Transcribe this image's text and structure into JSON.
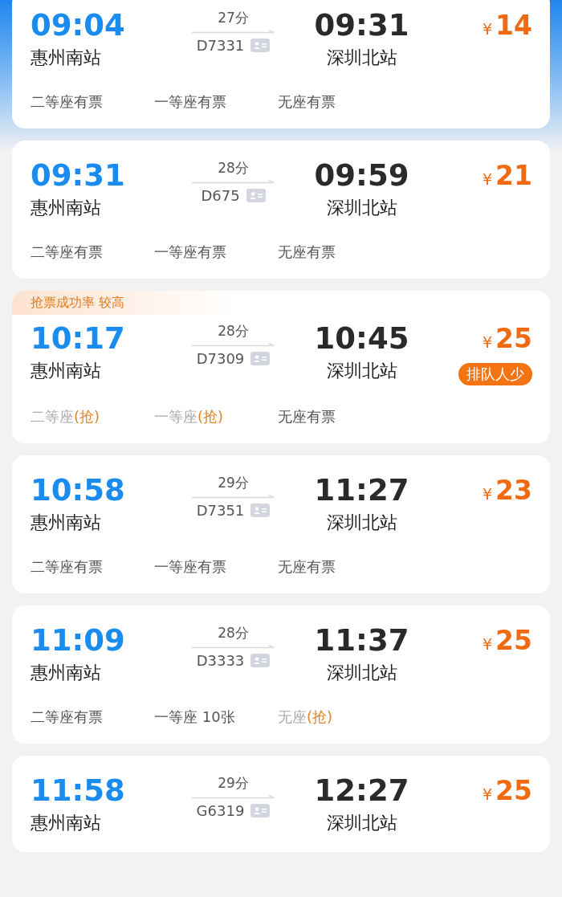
{
  "trains": [
    {
      "depart_time": "09:04",
      "depart_station": "惠州南站",
      "duration": "27分",
      "train_no": "D7331",
      "arrive_time": "09:31",
      "arrive_station": "深圳北站",
      "currency": "¥",
      "price": "14",
      "seats": [
        {
          "kind": "available",
          "text": "二等座有票"
        },
        {
          "kind": "available",
          "text": "一等座有票"
        },
        {
          "kind": "available",
          "text": "无座有票"
        }
      ]
    },
    {
      "depart_time": "09:31",
      "depart_station": "惠州南站",
      "duration": "28分",
      "train_no": "D675",
      "arrive_time": "09:59",
      "arrive_station": "深圳北站",
      "currency": "¥",
      "price": "21",
      "seats": [
        {
          "kind": "available",
          "text": "二等座有票"
        },
        {
          "kind": "available",
          "text": "一等座有票"
        },
        {
          "kind": "available",
          "text": "无座有票"
        }
      ]
    },
    {
      "banner": "抢票成功率 较高",
      "depart_time": "10:17",
      "depart_station": "惠州南站",
      "duration": "28分",
      "train_no": "D7309",
      "arrive_time": "10:45",
      "arrive_station": "深圳北站",
      "currency": "¥",
      "price": "25",
      "badge": "排队人少",
      "seats": [
        {
          "kind": "grab",
          "text": "二等座",
          "grab": "(抢)"
        },
        {
          "kind": "grab",
          "text": "一等座",
          "grab": "(抢)"
        },
        {
          "kind": "available",
          "text": "无座有票"
        }
      ]
    },
    {
      "depart_time": "10:58",
      "depart_station": "惠州南站",
      "duration": "29分",
      "train_no": "D7351",
      "arrive_time": "11:27",
      "arrive_station": "深圳北站",
      "currency": "¥",
      "price": "23",
      "seats": [
        {
          "kind": "available",
          "text": "二等座有票"
        },
        {
          "kind": "available",
          "text": "一等座有票"
        },
        {
          "kind": "available",
          "text": "无座有票"
        }
      ]
    },
    {
      "depart_time": "11:09",
      "depart_station": "惠州南站",
      "duration": "28分",
      "train_no": "D3333",
      "arrive_time": "11:37",
      "arrive_station": "深圳北站",
      "currency": "¥",
      "price": "25",
      "seats": [
        {
          "kind": "available",
          "text": "二等座有票"
        },
        {
          "kind": "available",
          "text": "一等座 10张"
        },
        {
          "kind": "grab",
          "text": "无座",
          "grab": "(抢)"
        }
      ]
    },
    {
      "depart_time": "11:58",
      "depart_station": "惠州南站",
      "duration": "29分",
      "train_no": "G6319",
      "arrive_time": "12:27",
      "arrive_station": "深圳北站",
      "currency": "¥",
      "price": "25"
    }
  ]
}
